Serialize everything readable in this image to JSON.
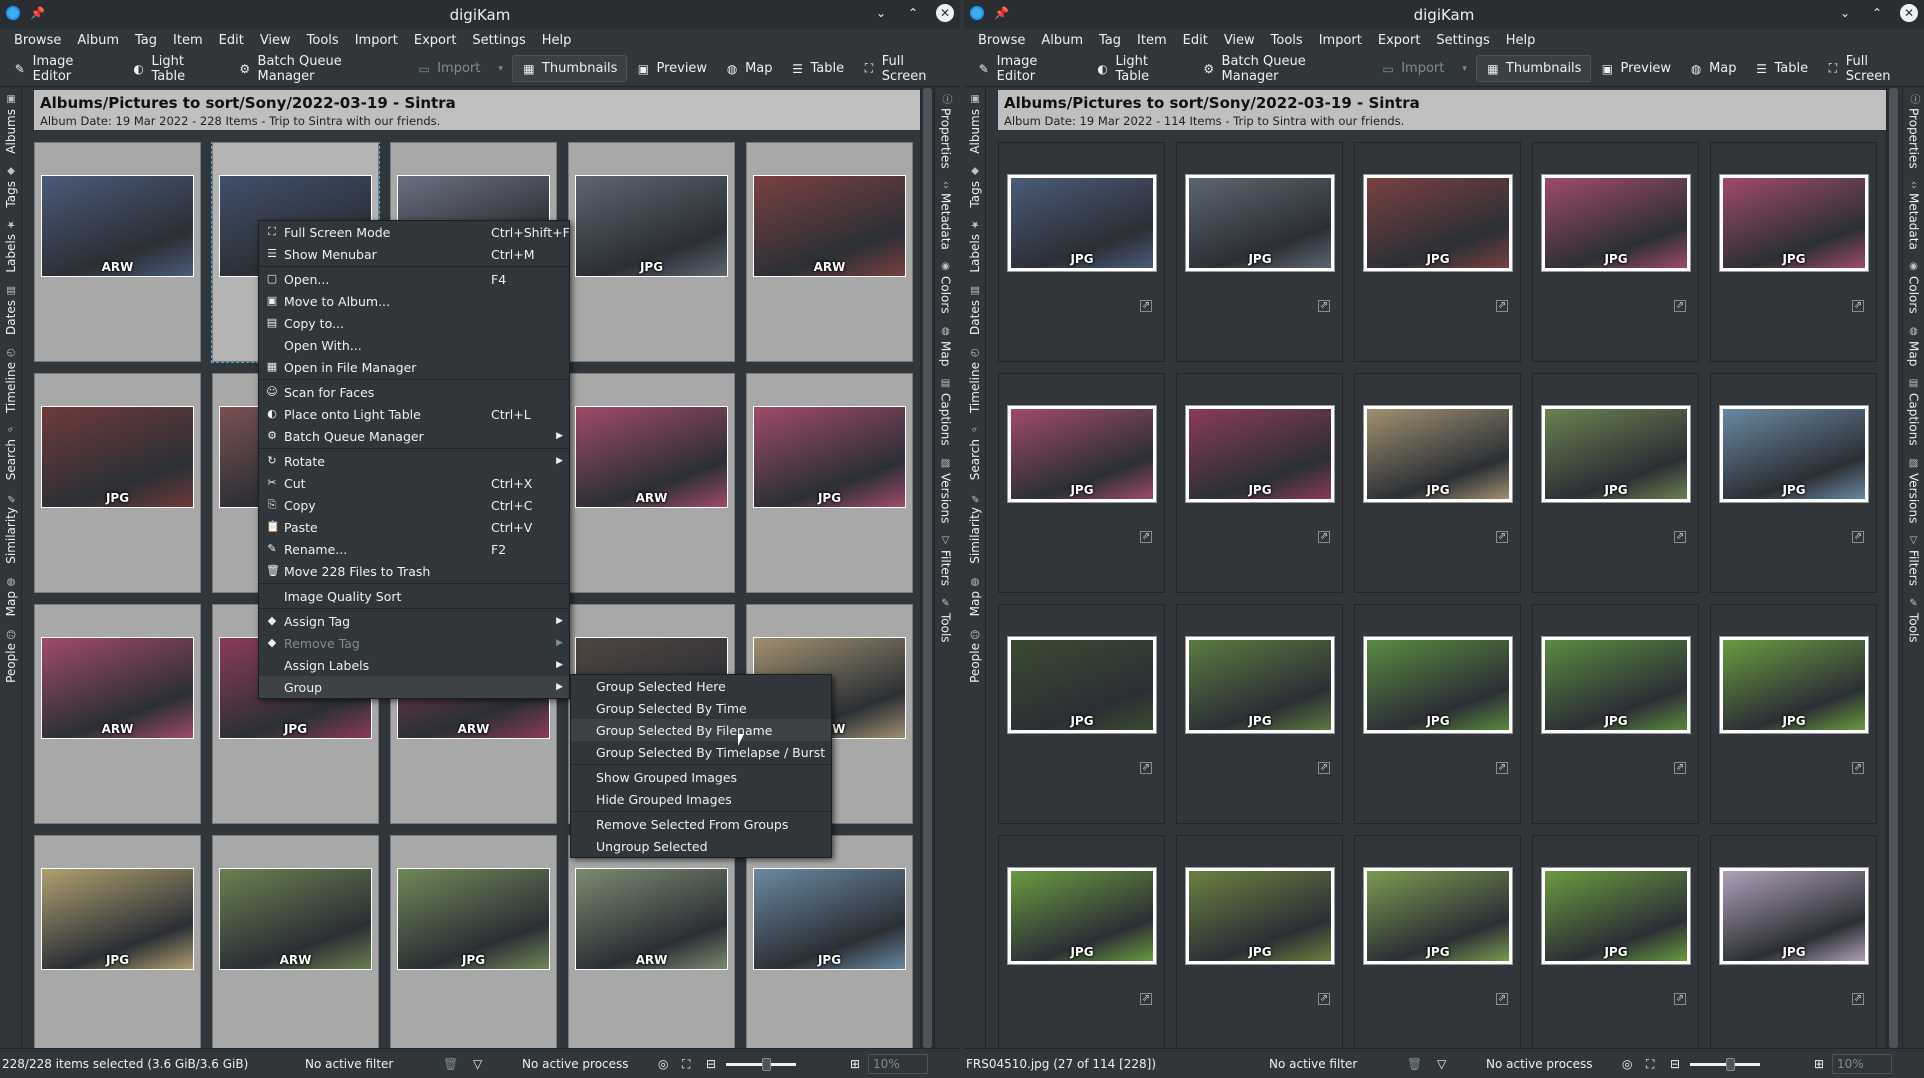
{
  "left": {
    "title": "digiKam",
    "menubar": [
      "Browse",
      "Album",
      "Tag",
      "Item",
      "Edit",
      "View",
      "Tools",
      "Import",
      "Export",
      "Settings",
      "Help"
    ],
    "toolbar": {
      "image_editor": "Image Editor",
      "light_table": "Light Table",
      "batch_queue": "Batch Queue Manager",
      "import": "Import",
      "thumbnails": "Thumbnails",
      "preview": "Preview",
      "map": "Map",
      "table": "Table",
      "full_screen": "Full Screen"
    },
    "left_tabs": [
      "Albums",
      "Tags",
      "Labels",
      "Dates",
      "Timeline",
      "Search",
      "Similarity",
      "Map",
      "People"
    ],
    "right_tabs": [
      "Properties",
      "Metadata",
      "Colors",
      "Map",
      "Captions",
      "Versions",
      "Filters",
      "Tools"
    ],
    "album": {
      "title": "Albums/Pictures to sort/Sony/2022-03-19 - Sintra",
      "info": "Album Date: 19 Mar 2022 - 228 Items - Trip to Sintra with our friends."
    },
    "thumbs": [
      {
        "fmt": "ARW",
        "color": "#4a5a78"
      },
      {
        "fmt": "",
        "color": "#3f4f6a"
      },
      {
        "fmt": "",
        "color": "#6b7080"
      },
      {
        "fmt": "JPG",
        "color": "#5c6570"
      },
      {
        "fmt": "ARW",
        "color": "#7a4040"
      },
      {
        "fmt": "JPG",
        "color": "#6e3a3a"
      },
      {
        "fmt": "",
        "color": "#7a5050"
      },
      {
        "fmt": "",
        "color": "#7a4a55"
      },
      {
        "fmt": "ARW",
        "color": "#a04a6a"
      },
      {
        "fmt": "JPG",
        "color": "#a04a6a"
      },
      {
        "fmt": "ARW",
        "color": "#a04a6a"
      },
      {
        "fmt": "JPG",
        "color": "#8a3a5a"
      },
      {
        "fmt": "ARW",
        "color": "#8a3a5a"
      },
      {
        "fmt": "",
        "color": "#504540"
      },
      {
        "fmt": "ARW",
        "color": "#a09070"
      },
      {
        "fmt": "JPG",
        "color": "#b0a070"
      },
      {
        "fmt": "ARW",
        "color": "#6a8050"
      },
      {
        "fmt": "JPG",
        "color": "#708858"
      },
      {
        "fmt": "ARW",
        "color": "#7a8a70"
      },
      {
        "fmt": "JPG",
        "color": "#6a88a0"
      }
    ],
    "status": {
      "selection": "228/228 items selected (3.6 GiB/3.6 GiB)",
      "filter": "No active filter",
      "process": "No active process",
      "zoom": "10%"
    }
  },
  "context_menu": {
    "items": [
      {
        "label": "Full Screen Mode",
        "shortcut": "Ctrl+Shift+F",
        "icon": "fullscreen-icon",
        "glyph": "⛶"
      },
      {
        "label": "Show Menubar",
        "shortcut": "Ctrl+M",
        "icon": "menubar-icon",
        "glyph": "☰"
      },
      {
        "sep": true
      },
      {
        "label": "Open...",
        "shortcut": "F4",
        "icon": "open-icon",
        "glyph": "▢"
      },
      {
        "label": "Move to Album...",
        "shortcut": "",
        "icon": "move-icon",
        "glyph": "▣"
      },
      {
        "label": "Copy to...",
        "shortcut": "",
        "icon": "copy-to-icon",
        "glyph": "▤"
      },
      {
        "label": "Open With...",
        "shortcut": "",
        "icon": "",
        "glyph": ""
      },
      {
        "label": "Open in File Manager",
        "shortcut": "",
        "icon": "file-manager-icon",
        "glyph": "▦"
      },
      {
        "sep": true
      },
      {
        "label": "Scan for Faces",
        "shortcut": "",
        "icon": "face-icon",
        "glyph": "☺"
      },
      {
        "label": "Place onto Light Table",
        "shortcut": "Ctrl+L",
        "icon": "light-table-icon",
        "glyph": "◐"
      },
      {
        "label": "Batch Queue Manager",
        "shortcut": "",
        "icon": "batch-icon",
        "glyph": "⚙",
        "sub": true
      },
      {
        "sep": true
      },
      {
        "label": "Rotate",
        "shortcut": "",
        "icon": "rotate-icon",
        "glyph": "↻",
        "sub": true
      },
      {
        "label": "Cut",
        "shortcut": "Ctrl+X",
        "icon": "cut-icon",
        "glyph": "✂"
      },
      {
        "label": "Copy",
        "shortcut": "Ctrl+C",
        "icon": "copy-icon",
        "glyph": "⎘"
      },
      {
        "label": "Paste",
        "shortcut": "Ctrl+V",
        "icon": "paste-icon",
        "glyph": "📋"
      },
      {
        "label": "Rename...",
        "shortcut": "F2",
        "icon": "rename-icon",
        "glyph": "✎"
      },
      {
        "label": "Move 228 Files to Trash",
        "shortcut": "",
        "icon": "trash-icon",
        "glyph": "🗑"
      },
      {
        "sep": true
      },
      {
        "label": "Image Quality Sort",
        "shortcut": "",
        "icon": "",
        "glyph": ""
      },
      {
        "sep": true
      },
      {
        "label": "Assign Tag",
        "shortcut": "",
        "icon": "tag-icon",
        "glyph": "◆",
        "sub": true
      },
      {
        "label": "Remove Tag",
        "shortcut": "",
        "icon": "remove-tag-icon",
        "glyph": "◆",
        "sub": true,
        "disabled": true
      },
      {
        "label": "Assign Labels",
        "shortcut": "",
        "icon": "",
        "glyph": "",
        "sub": true
      },
      {
        "label": "Group",
        "shortcut": "",
        "icon": "",
        "glyph": "",
        "sub": true,
        "highlight": true
      }
    ]
  },
  "group_submenu": {
    "items": [
      {
        "label": "Group Selected Here"
      },
      {
        "label": "Group Selected By Time"
      },
      {
        "label": "Group Selected By Filename",
        "highlight": true
      },
      {
        "label": "Group Selected By Timelapse / Burst"
      },
      {
        "sep": true
      },
      {
        "label": "Show Grouped Images"
      },
      {
        "label": "Hide Grouped Images"
      },
      {
        "sep": true
      },
      {
        "label": "Remove Selected From Groups"
      },
      {
        "label": "Ungroup Selected"
      }
    ]
  },
  "right": {
    "title": "digiKam",
    "album": {
      "title": "Albums/Pictures to sort/Sony/2022-03-19 - Sintra",
      "info": "Album Date: 19 Mar 2022 - 114 Items - Trip to Sintra with our friends."
    },
    "thumbs": [
      {
        "fmt": "JPG",
        "color": "#4a5a78"
      },
      {
        "fmt": "JPG",
        "color": "#5c6570"
      },
      {
        "fmt": "JPG",
        "color": "#7a4040"
      },
      {
        "fmt": "JPG",
        "color": "#a04a6a"
      },
      {
        "fmt": "JPG",
        "color": "#a04a6a"
      },
      {
        "fmt": "JPG",
        "color": "#a04a6a"
      },
      {
        "fmt": "JPG",
        "color": "#8a3a5a"
      },
      {
        "fmt": "JPG",
        "color": "#a09070"
      },
      {
        "fmt": "JPG",
        "color": "#6a8050"
      },
      {
        "fmt": "JPG",
        "color": "#6a88a0"
      },
      {
        "fmt": "JPG",
        "color": "#3a4a30"
      },
      {
        "fmt": "JPG",
        "color": "#5a7a40"
      },
      {
        "fmt": "JPG",
        "color": "#5a8a40"
      },
      {
        "fmt": "JPG",
        "color": "#5a8a40"
      },
      {
        "fmt": "JPG",
        "color": "#6a9a40"
      },
      {
        "fmt": "JPG",
        "color": "#6a9a40"
      },
      {
        "fmt": "JPG",
        "color": "#6a8040"
      },
      {
        "fmt": "JPG",
        "color": "#7a9a50"
      },
      {
        "fmt": "JPG",
        "color": "#6a9a40"
      },
      {
        "fmt": "JPG",
        "color": "#b0a0b8"
      }
    ],
    "status": {
      "selection": "FRS04510.jpg (27 of 114 [228])",
      "filter": "No active filter",
      "process": "No active process",
      "zoom": "10%"
    }
  }
}
